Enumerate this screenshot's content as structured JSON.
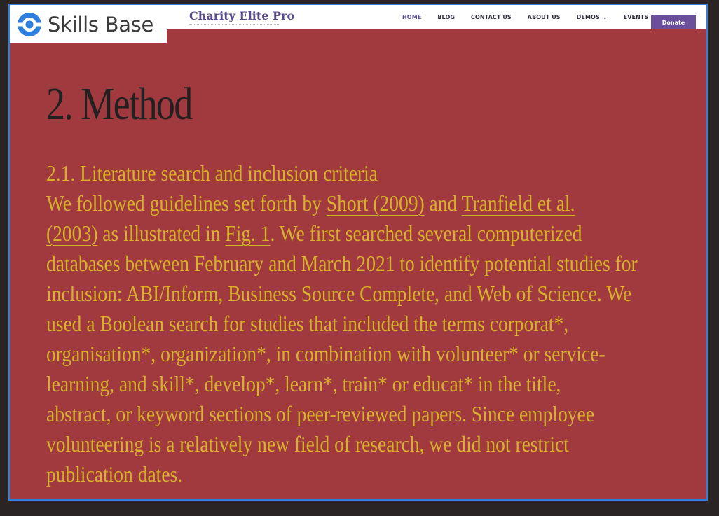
{
  "brand": {
    "logo_text": "Skills Base",
    "logo_icon": "skills-base-logo-icon",
    "accent": "#2f7fe0"
  },
  "site": {
    "title": "Charity Elite Pro"
  },
  "nav": {
    "items": [
      {
        "label": "HOME"
      },
      {
        "label": "BLOG"
      },
      {
        "label": "CONTACT US"
      },
      {
        "label": "ABOUT US"
      },
      {
        "label": "DEMOS"
      },
      {
        "label": "EVENTS"
      }
    ],
    "donate_label": "Donate",
    "donate_color": "#6b4f9c"
  },
  "article": {
    "background": "#a13a3e",
    "heading": "2. Method",
    "subheading": "2.1. Literature search and inclusion criteria",
    "lines": [
      {
        "pre": "We followed guidelines set forth by ",
        "link1": "Short (2009)",
        "mid": " and ",
        "link2": "Tranfield et al."
      },
      {
        "link1": "(2003)",
        "mid": " as illustrated in ",
        "link2": "Fig. 1",
        "post": ". We first searched several computerized"
      },
      {
        "text": "databases between February and March 2021 to identify potential studies for"
      },
      {
        "text": "inclusion: ABI/Inform, Business Source Complete, and Web of Science. We"
      },
      {
        "text": "used a Boolean search for studies that included the terms corporat*,"
      },
      {
        "text": "organisation*, organization*, in combination with volunteer* or service-"
      },
      {
        "text": "learning, and skill*, develop*, learn*, train* or educat* in the title,"
      },
      {
        "text": "abstract, or keyword sections of peer-reviewed papers. Since employee"
      },
      {
        "text": "volunteering is a relatively new field of research, we did not restrict"
      },
      {
        "text": "publication dates."
      }
    ]
  }
}
